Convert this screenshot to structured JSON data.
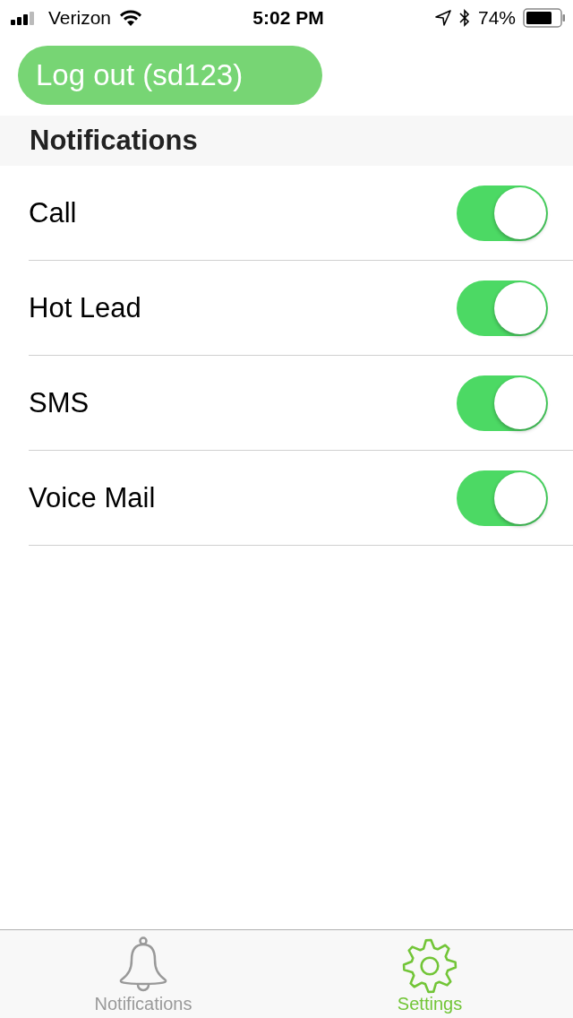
{
  "status_bar": {
    "carrier": "Verizon",
    "time": "5:02 PM",
    "battery": "74%"
  },
  "logout_button": {
    "label": "Log out (sd123)"
  },
  "section": {
    "title": "Notifications"
  },
  "settings": [
    {
      "label": "Call",
      "on": true
    },
    {
      "label": "Hot Lead",
      "on": true
    },
    {
      "label": "SMS",
      "on": true
    },
    {
      "label": "Voice Mail",
      "on": true
    }
  ],
  "tabs": [
    {
      "label": "Notifications",
      "kind": "bell",
      "selected": false
    },
    {
      "label": "Settings",
      "kind": "gear",
      "selected": true
    }
  ]
}
